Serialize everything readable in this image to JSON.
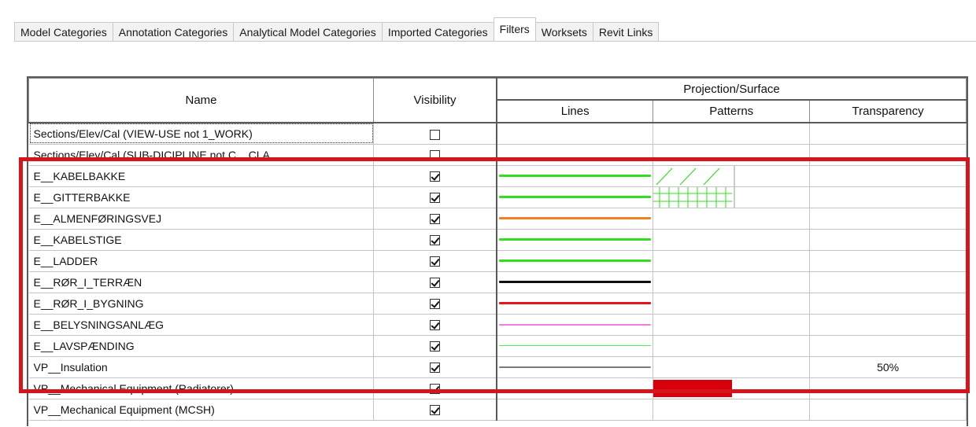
{
  "tabs": [
    {
      "label": "Model Categories",
      "active": false
    },
    {
      "label": "Annotation Categories",
      "active": false
    },
    {
      "label": "Analytical Model Categories",
      "active": false
    },
    {
      "label": "Imported Categories",
      "active": false
    },
    {
      "label": "Filters",
      "active": true
    },
    {
      "label": "Worksets",
      "active": false
    },
    {
      "label": "Revit Links",
      "active": false
    }
  ],
  "table": {
    "headers": {
      "name": "Name",
      "visibility": "Visibility",
      "group": "Projection/Surface",
      "lines": "Lines",
      "patterns": "Patterns",
      "transparency": "Transparency"
    },
    "rows": [
      {
        "name": "Sections/Elev/Cal (VIEW-USE not 1_WORK)",
        "visible": false,
        "line": null,
        "pattern": null,
        "transparency": ""
      },
      {
        "name": "Sections/Elev/Cal (SUB-DICIPLINE not C__CLA...",
        "visible": false,
        "line": null,
        "pattern": null,
        "transparency": ""
      },
      {
        "name": "E__KABELBAKKE",
        "visible": true,
        "line": {
          "color": "#33dd22",
          "weight": 3
        },
        "pattern": "green-diagonal",
        "transparency": ""
      },
      {
        "name": "E__GITTERBAKKE",
        "visible": true,
        "line": {
          "color": "#33dd22",
          "weight": 3
        },
        "pattern": "green-grid",
        "transparency": ""
      },
      {
        "name": "E__ALMENFØRINGSVEJ",
        "visible": true,
        "line": {
          "color": "#f08020",
          "weight": 3
        },
        "pattern": null,
        "transparency": ""
      },
      {
        "name": "E__KABELSTIGE",
        "visible": true,
        "line": {
          "color": "#33dd22",
          "weight": 3
        },
        "pattern": null,
        "transparency": ""
      },
      {
        "name": "E__LADDER",
        "visible": true,
        "line": {
          "color": "#33dd22",
          "weight": 3
        },
        "pattern": null,
        "transparency": ""
      },
      {
        "name": "E__RØR_I_TERRÆN",
        "visible": true,
        "line": {
          "color": "#111111",
          "weight": 3
        },
        "pattern": null,
        "transparency": ""
      },
      {
        "name": "E__RØR_I_BYGNING",
        "visible": true,
        "line": {
          "color": "#e8141c",
          "weight": 3
        },
        "pattern": null,
        "transparency": ""
      },
      {
        "name": "E__BELYSNINGSANLÆG",
        "visible": true,
        "line": {
          "color": "#f07ee0",
          "weight": 2
        },
        "pattern": null,
        "transparency": ""
      },
      {
        "name": "E__LAVSPÆNDING",
        "visible": true,
        "line": {
          "color": "#55e855",
          "weight": 1
        },
        "pattern": null,
        "transparency": ""
      },
      {
        "name": "VP__Insulation",
        "visible": true,
        "line": {
          "color": "#7a7a7a",
          "weight": 2
        },
        "pattern": null,
        "transparency": "50%"
      },
      {
        "name": "VP__Mechanical Equipment (Radiatorer)",
        "visible": true,
        "line": null,
        "pattern": "red-solid",
        "transparency": ""
      },
      {
        "name": "VP__Mechanical Equipment (MCSH)",
        "visible": true,
        "line": null,
        "pattern": null,
        "transparency": ""
      }
    ]
  },
  "annotation": {
    "highlight_color": "#d4151c"
  }
}
